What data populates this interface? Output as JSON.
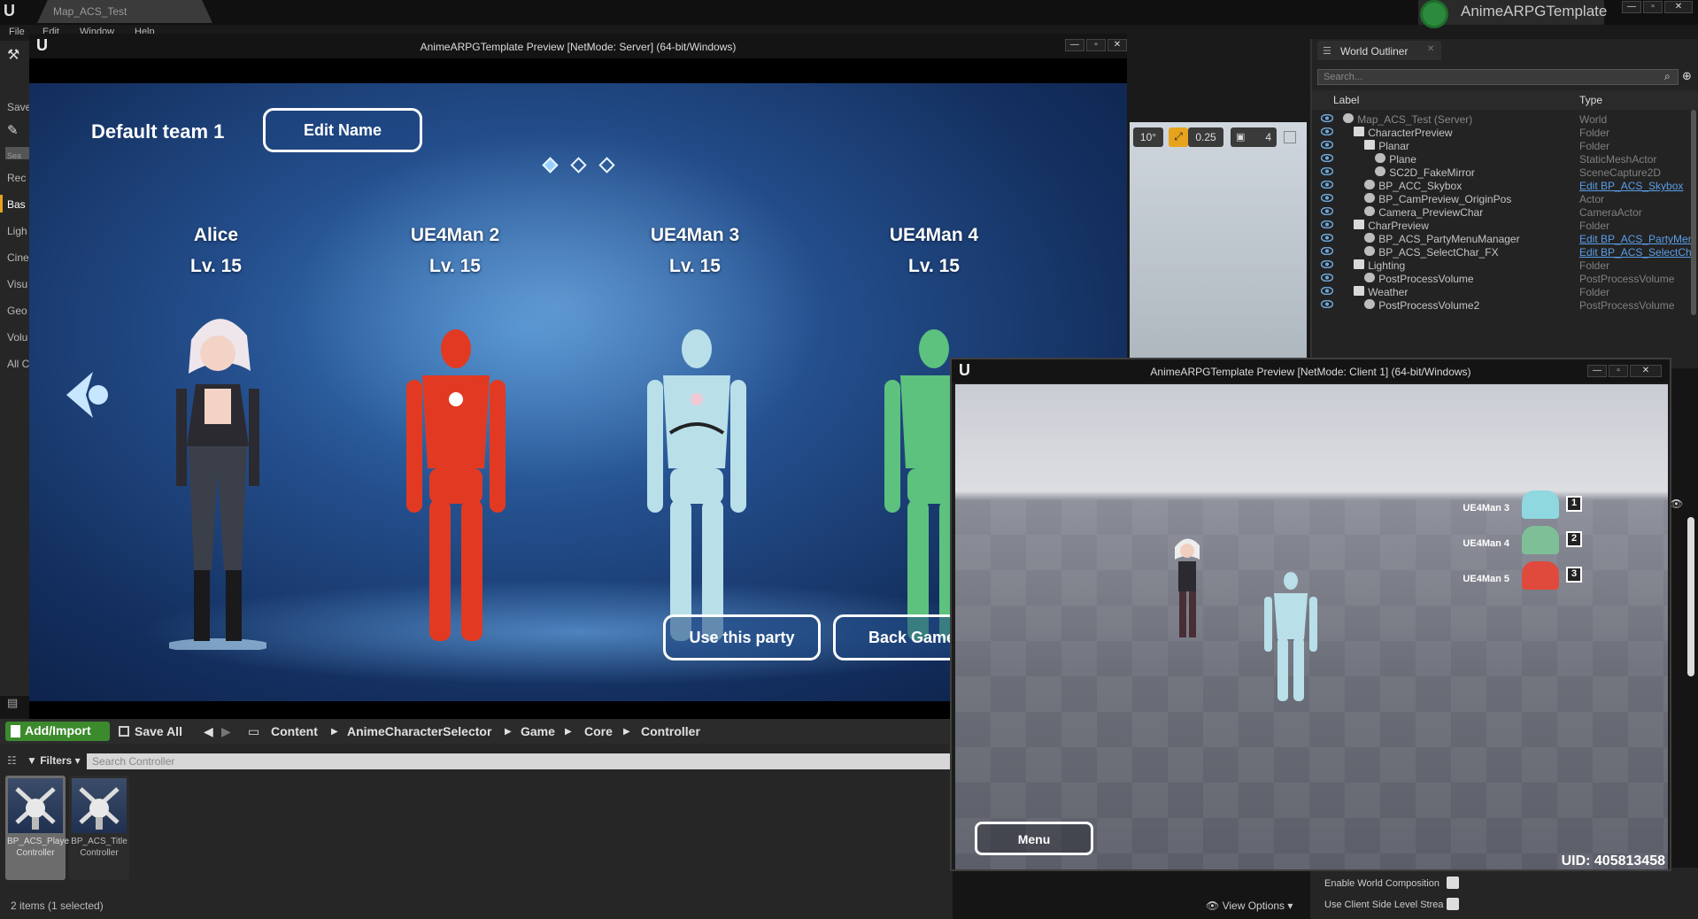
{
  "editor": {
    "tab_title": "Map_ACS_Test",
    "menu": [
      "File",
      "Edit",
      "Window",
      "Help"
    ],
    "project_name": "AnimeARPGTemplate",
    "save_label": "Save"
  },
  "left_strip": {
    "items": [
      "Sea",
      "Rec",
      "Bas",
      "Ligh",
      "Cine",
      "Visu",
      "Geo",
      "Volu",
      "All C"
    ]
  },
  "pie_main": {
    "title": "AnimeARPGTemplate Preview [NetMode: Server]  (64-bit/Windows)",
    "team_name": "Default team 1",
    "edit_name_label": "Edit Name",
    "characters": [
      {
        "name": "Alice",
        "level": "Lv. 15"
      },
      {
        "name": "UE4Man 2",
        "level": "Lv. 15"
      },
      {
        "name": "UE4Man 3",
        "level": "Lv. 15"
      },
      {
        "name": "UE4Man 4",
        "level": "Lv. 15"
      }
    ],
    "use_party_label": "Use this party",
    "back_game_label": "Back Game"
  },
  "viewport_toolbar": {
    "rotation_snap": "10°",
    "scale_snap": "0.25",
    "camera_speed": "4"
  },
  "outliner": {
    "title": "World Outliner",
    "search_placeholder": "Search...",
    "col_label": "Label",
    "col_type": "Type",
    "rows": [
      {
        "label": "Map_ACS_Test (Server)",
        "type": "World"
      },
      {
        "label": "CharacterPreview",
        "type": "Folder"
      },
      {
        "label": "Planar",
        "type": "Folder"
      },
      {
        "label": "Plane",
        "type": "StaticMeshActor"
      },
      {
        "label": "SC2D_FakeMirror",
        "type": "SceneCapture2D"
      },
      {
        "label": "BP_ACC_Skybox",
        "type": "Edit BP_ACS_Skybox"
      },
      {
        "label": "BP_CamPreview_OriginPos",
        "type": "Actor"
      },
      {
        "label": "Camera_PreviewChar",
        "type": "CameraActor"
      },
      {
        "label": "CharPreview",
        "type": "Folder"
      },
      {
        "label": "BP_ACS_PartyMenuManager",
        "type": "Edit BP_ACS_PartyMenuManager"
      },
      {
        "label": "BP_ACS_SelectChar_FX",
        "type": "Edit BP_ACS_SelectChar_FX"
      },
      {
        "label": "Lighting",
        "type": "Folder"
      },
      {
        "label": "PostProcessVolume",
        "type": "PostProcessVolume"
      },
      {
        "label": "Weather",
        "type": "Folder"
      },
      {
        "label": "PostProcessVolume2",
        "type": "PostProcessVolume"
      }
    ]
  },
  "pie_client": {
    "title": "AnimeARPGTemplate Preview [NetMode: Client 1]  (64-bit/Windows)",
    "party": [
      {
        "name": "UE4Man 3",
        "slot": "1",
        "color": "#8fd8e0"
      },
      {
        "name": "UE4Man 4",
        "slot": "2",
        "color": "#7fbf98"
      },
      {
        "name": "UE4Man 5",
        "slot": "3",
        "color": "#e04a3c"
      }
    ],
    "menu_label": "Menu",
    "uid_text": "UID: 405813458"
  },
  "content_browser": {
    "add_import_label": "Add/Import",
    "save_all_label": "Save All",
    "breadcrumb": [
      "Content",
      "AnimeCharacterSelector",
      "Game",
      "Core",
      "Controller"
    ],
    "filters_label": "Filters",
    "search_placeholder": "Search Controller",
    "assets": [
      {
        "name": "BP_ACS_Player Controller"
      },
      {
        "name": "BP_ACS_Title Controller"
      }
    ],
    "status": "2 items (1 selected)",
    "view_options_label": "View Options"
  },
  "details": {
    "enable_world_composition": "Enable World Composition",
    "use_client_side_level_streaming": "Use Client Side Level Strea"
  }
}
